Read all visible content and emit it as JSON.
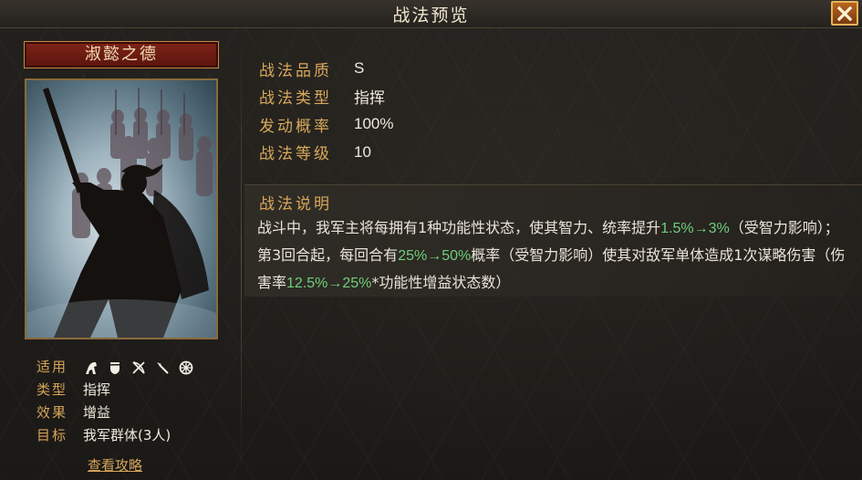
{
  "window": {
    "title": "战法预览"
  },
  "skill": {
    "name": "淑懿之德"
  },
  "left_props": {
    "applicable_label": "适用",
    "troop_icons": [
      "cavalry-icon",
      "shield-icon",
      "bow-icon",
      "spear-icon",
      "siege-icon"
    ],
    "type_label": "类型",
    "type_value": "指挥",
    "effect_label": "效果",
    "effect_value": "增益",
    "target_label": "目标",
    "target_value": "我军群体(3人)",
    "strategy_link": "查看攻略"
  },
  "stats": {
    "quality_label": "战法品质",
    "quality_value": "S",
    "category_label": "战法类型",
    "category_value": "指挥",
    "chance_label": "发动概率",
    "chance_value": "100%",
    "level_label": "战法等级",
    "level_value": "10"
  },
  "description": {
    "title": "战法说明",
    "p1": "战斗中，我军主将每拥有1种功能性状态，使其智力、统率提升",
    "p1_hl": "1.5%→3%",
    "p2": "（受智力影响）；第3回合起，每回合有",
    "p2_hl": "25%→50%",
    "p3": "概率（受智力影响）使其对敌军单体造成1次谋略伤害（伤害率",
    "p3_hl": "12.5%→25%",
    "p4": "*功能性增益状态数）"
  },
  "colors": {
    "accent_gold": "#d9a85c",
    "highlight_green": "#6fcf7a",
    "name_plate_red": "#7e2418"
  }
}
